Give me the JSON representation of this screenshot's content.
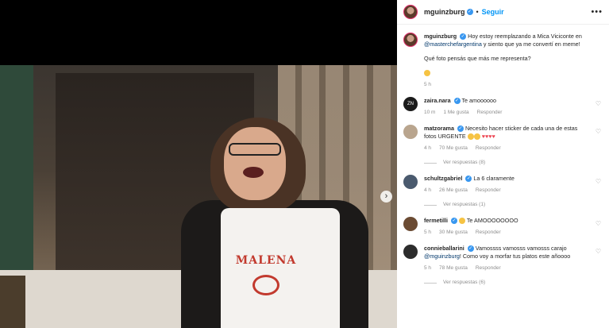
{
  "post": {
    "username": "mguinzburg",
    "follow_label": "Seguir",
    "caption_username": "mguinzburg",
    "caption_text": "Hoy estoy reemplazando a Mica Viciconte en",
    "caption_mention": "@masterchefargentina",
    "caption_text2": "y siento que ya me convertí en meme!",
    "caption_question": "Qué foto pensás que más me representa?",
    "caption_time": "5 h",
    "apron_name": "MALENA"
  },
  "comments": [
    {
      "user": "zaira.nara",
      "avatar_text": "ZN",
      "text": "Te amoooooo",
      "time": "10 m",
      "likes": "1 Me gusta",
      "reply": "Responder",
      "replies": ""
    },
    {
      "user": "matzorama",
      "avatar_text": "",
      "text": "Necesito hacer sticker de cada una de estas fotos URGENTE",
      "time": "4 h",
      "likes": "70 Me gusta",
      "reply": "Responder",
      "replies": "Ver respuestas (8)"
    },
    {
      "user": "schultzgabriel",
      "avatar_text": "",
      "text": "La 6 claramente",
      "time": "4 h",
      "likes": "26 Me gusta",
      "reply": "Responder",
      "replies": "Ver respuestas (1)"
    },
    {
      "user": "fermetilli",
      "avatar_text": "",
      "text": "Te AMOOOOOOOO",
      "time": "5 h",
      "likes": "30 Me gusta",
      "reply": "Responder",
      "replies": ""
    },
    {
      "user": "connieballarini",
      "avatar_text": "",
      "text": "Vamossss vamosss vamosss carajo",
      "mention": "@mguinzburg",
      "text2": "! Como voy a morfar tus platos este añoooo",
      "time": "5 h",
      "likes": "78 Me gusta",
      "reply": "Responder",
      "replies": "Ver respuestas (6)"
    }
  ],
  "icons": {
    "more": "more-horizontal-icon",
    "heart": "heart-outline-icon",
    "next": "chevron-right-icon",
    "verified": "verified-badge-icon"
  }
}
